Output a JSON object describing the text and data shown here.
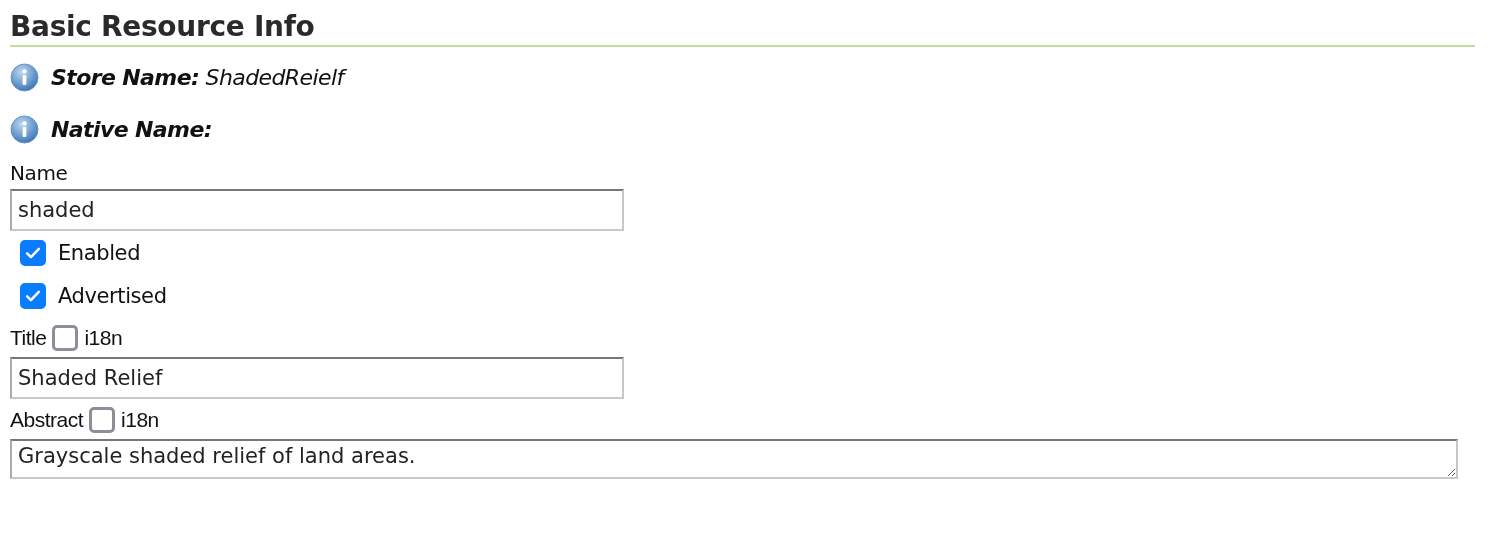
{
  "heading": "Basic Resource Info",
  "info": [
    {
      "label": "Store Name:",
      "value": "ShadedReielf"
    },
    {
      "label": "Native Name:"
    }
  ],
  "form": [
    {
      "kind": "text",
      "label": "Name",
      "value": "shaded"
    },
    {
      "kind": "checkbox",
      "label": "Enabled",
      "checked": true
    },
    {
      "kind": "checkbox",
      "label": "Advertised",
      "checked": true
    },
    {
      "kind": "i18n-text",
      "label": "Title",
      "i18n": {
        "label": "i18n",
        "checked": false
      },
      "value": "Shaded Relief"
    },
    {
      "kind": "i18n-textarea",
      "label": "Abstract",
      "i18n": {
        "label": "i18n",
        "checked": false
      },
      "value": "Grayscale shaded relief of land areas."
    }
  ]
}
